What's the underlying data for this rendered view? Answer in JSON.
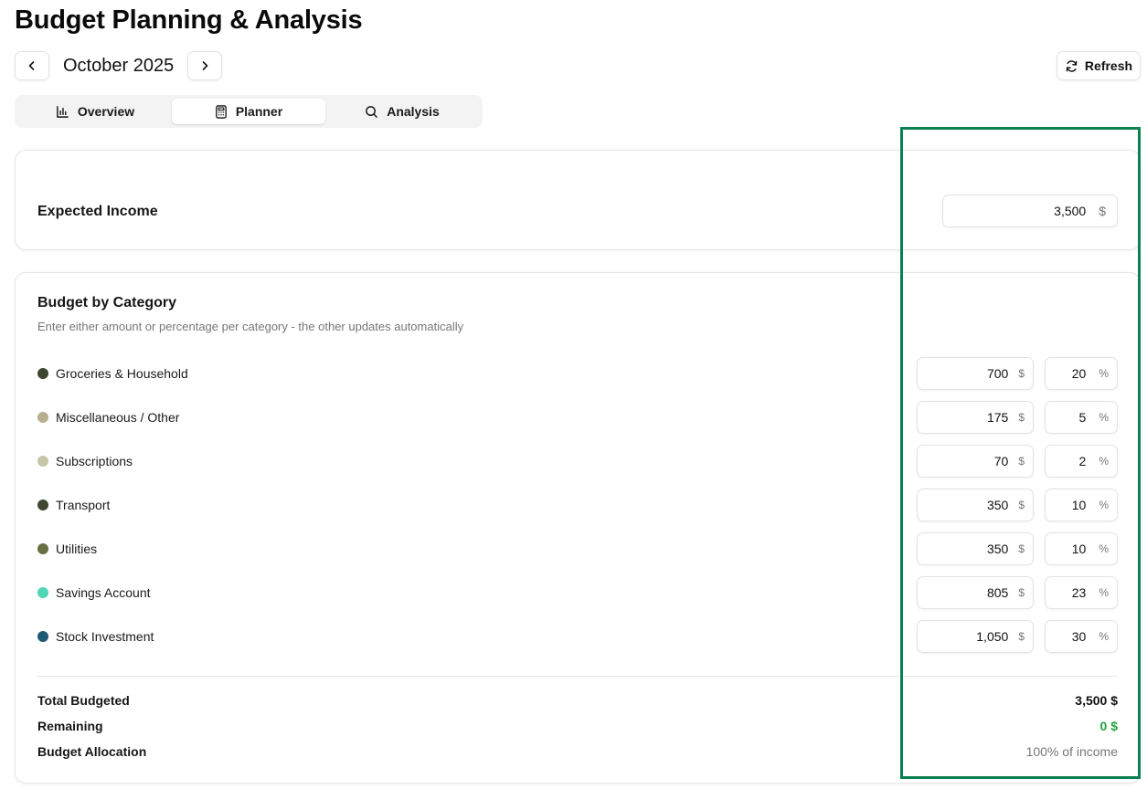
{
  "header": {
    "title": "Budget Planning & Analysis"
  },
  "month_nav": {
    "label": "October 2025"
  },
  "refresh": {
    "label": "Refresh"
  },
  "tabs": [
    {
      "label": "Overview",
      "icon": "bar-chart-icon"
    },
    {
      "label": "Planner",
      "icon": "calculator-icon",
      "active": true
    },
    {
      "label": "Analysis",
      "icon": "search-icon"
    }
  ],
  "income": {
    "label": "Expected Income",
    "value": "3,500",
    "unit": "$"
  },
  "budget": {
    "title": "Budget by Category",
    "subtitle": "Enter either amount or percentage per category - the other updates automatically",
    "categories": [
      {
        "label": "Groceries & Household",
        "amount": "700",
        "amount_unit": "$",
        "percent": "20",
        "percent_unit": "%",
        "color": "#3b4731"
      },
      {
        "label": "Miscellaneous / Other",
        "amount": "175",
        "amount_unit": "$",
        "percent": "5",
        "percent_unit": "%",
        "color": "#b7ae8f"
      },
      {
        "label": "Subscriptions",
        "amount": "70",
        "amount_unit": "$",
        "percent": "2",
        "percent_unit": "%",
        "color": "#c6c6a9"
      },
      {
        "label": "Transport",
        "amount": "350",
        "amount_unit": "$",
        "percent": "10",
        "percent_unit": "%",
        "color": "#3f4931"
      },
      {
        "label": "Utilities",
        "amount": "350",
        "amount_unit": "$",
        "percent": "10",
        "percent_unit": "%",
        "color": "#676e45"
      },
      {
        "label": "Savings Account",
        "amount": "805",
        "amount_unit": "$",
        "percent": "23",
        "percent_unit": "%",
        "color": "#4fd6b5"
      },
      {
        "label": "Stock Investment",
        "amount": "1,050",
        "amount_unit": "$",
        "percent": "30",
        "percent_unit": "%",
        "color": "#1e5a73"
      }
    ],
    "summary": {
      "total_label": "Total Budgeted",
      "total_value": "3,500 $",
      "remaining_label": "Remaining",
      "remaining_value": "0 $",
      "allocation_label": "Budget Allocation",
      "allocation_value": "100% of income"
    }
  },
  "colors": {
    "remaining_green": "#1fa33b",
    "highlight_border": "#0c8050"
  }
}
